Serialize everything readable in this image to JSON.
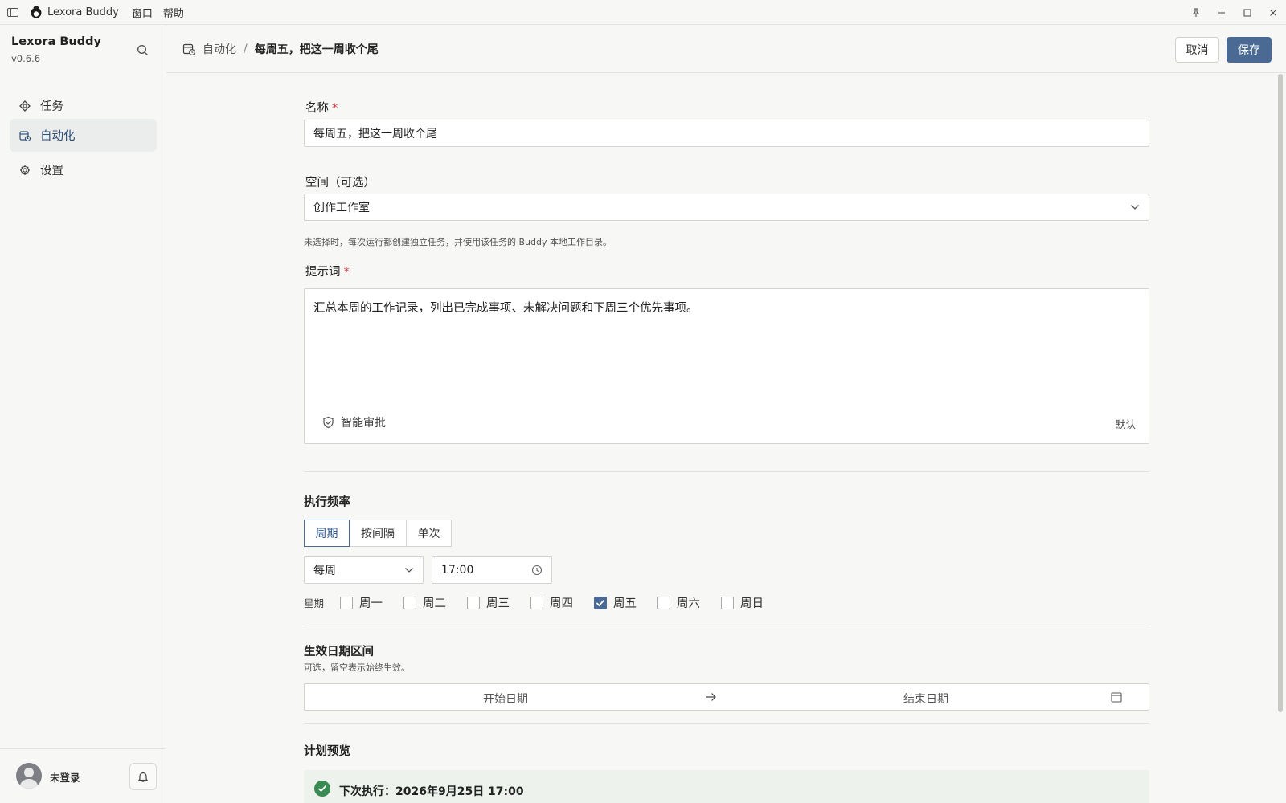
{
  "titlebar": {
    "app_name": "Lexora Buddy",
    "menus": [
      "窗口",
      "帮助"
    ]
  },
  "sidebar": {
    "title": "Lexora Buddy",
    "version": "v0.6.6",
    "items": [
      {
        "label": "任务",
        "icon": "diamond-icon"
      },
      {
        "label": "自动化",
        "icon": "calendar-clock-icon",
        "active": true
      },
      {
        "label": "设置",
        "icon": "gear-icon"
      }
    ],
    "user": {
      "name": "未登录"
    }
  },
  "header": {
    "breadcrumb_parent": "自动化",
    "breadcrumb_sep": "/",
    "breadcrumb_current": "每周五，把这一周收个尾",
    "cancel_label": "取消",
    "save_label": "保存"
  },
  "form": {
    "name": {
      "label": "名称",
      "required": "*",
      "value": "每周五，把这一周收个尾"
    },
    "space": {
      "label": "空间（可选）",
      "value": "创作工作室",
      "help": "未选择时，每次运行都创建独立任务，并使用该任务的 Buddy 本地工作目录。"
    },
    "prompt": {
      "label": "提示词",
      "required": "*",
      "value": "汇总本周的工作记录，列出已完成事项、未解决问题和下周三个优先事项。",
      "approval_label": "智能审批",
      "default_label": "默认"
    },
    "frequency": {
      "title": "执行频率",
      "modes": [
        "周期",
        "按间隔",
        "单次"
      ],
      "active_mode": "周期",
      "period_value": "每周",
      "time_value": "17:00",
      "weekday_label": "星期",
      "weekdays": [
        {
          "label": "周一",
          "checked": false
        },
        {
          "label": "周二",
          "checked": false
        },
        {
          "label": "周三",
          "checked": false
        },
        {
          "label": "周四",
          "checked": false
        },
        {
          "label": "周五",
          "checked": true
        },
        {
          "label": "周六",
          "checked": false
        },
        {
          "label": "周日",
          "checked": false
        }
      ]
    },
    "date_range": {
      "title": "生效日期区间",
      "help": "可选，留空表示始终生效。",
      "start_placeholder": "开始日期",
      "end_placeholder": "结束日期"
    },
    "preview": {
      "title": "计划预览",
      "next_run": "下次执行：2026年9月25日 17:00"
    }
  },
  "colors": {
    "accent": "#4a6a94",
    "required": "#d9363e",
    "success": "#3a8b52",
    "active_bg": "#ebecec"
  }
}
